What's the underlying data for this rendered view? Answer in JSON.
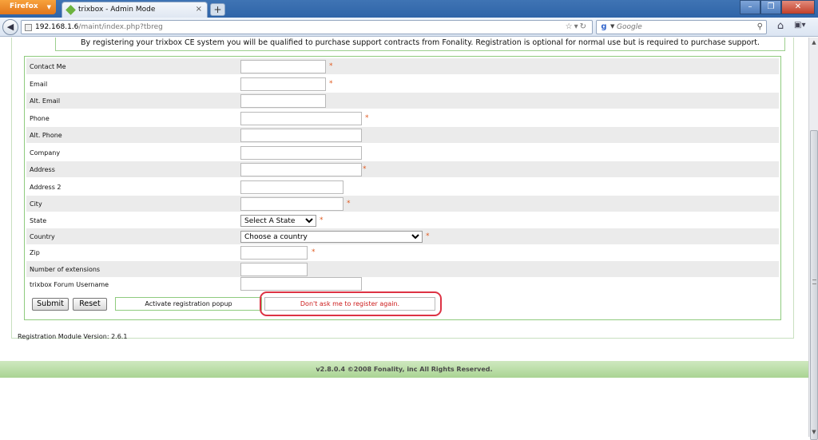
{
  "browser": {
    "menu_label": "Firefox",
    "tab_title": "trixbox - Admin Mode",
    "url_host": "192.168.1.6",
    "url_path": "/maint/index.php?tbreg",
    "search_placeholder": "Google"
  },
  "notice": "By registering your trixbox CE system you will be qualified to purchase support contracts from Fonality. Registration is optional for normal use but is required to purchase support.",
  "form": {
    "fields": [
      {
        "label": "Contact Me",
        "required": true
      },
      {
        "label": "Email",
        "required": true
      },
      {
        "label": "Alt. Email",
        "required": false
      },
      {
        "label": "Phone",
        "required": true
      },
      {
        "label": "Alt. Phone",
        "required": false
      },
      {
        "label": "Company",
        "required": false
      },
      {
        "label": "Address",
        "required": true
      },
      {
        "label": "Address 2",
        "required": false
      },
      {
        "label": "City",
        "required": true
      },
      {
        "label": "State",
        "required": true,
        "selected": "Select A State"
      },
      {
        "label": "Country",
        "required": true,
        "selected": "Choose a country"
      },
      {
        "label": "Zip",
        "required": true
      },
      {
        "label": "Number of extensions",
        "required": false
      },
      {
        "label": "trixbox Forum Username",
        "required": false
      }
    ],
    "required_marker": "*",
    "submit_label": "Submit",
    "reset_label": "Reset",
    "activate_popup_label": "Activate registration popup",
    "dont_ask_label": "Don't ask me to register again."
  },
  "version_text": "Registration Module Version: 2.6.1",
  "footer_text": "v2.8.0.4 ©2008 Fonality, inc All Rights Reserved.",
  "colors": {
    "accent_green": "#8fcb7e",
    "required_orange": "#e05a20",
    "highlight_red": "#dd3344"
  }
}
